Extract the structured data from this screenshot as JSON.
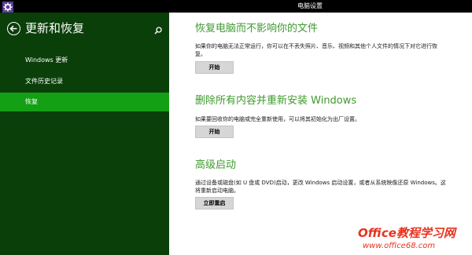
{
  "window": {
    "title": "电脑设置",
    "app_icon": "gear-icon"
  },
  "sidebar": {
    "title": "更新和恢复",
    "back_icon": "back-arrow-icon",
    "search_icon": "search-icon",
    "items": [
      {
        "label": "Windows 更新",
        "active": false
      },
      {
        "label": "文件历史记录",
        "active": false
      },
      {
        "label": "恢复",
        "active": true
      }
    ]
  },
  "sections": [
    {
      "title": "恢复电脑而不影响你的文件",
      "description": "如果你的电脑无法正常运行，你可以在不丢失照片、音乐、视频和其他个人文件的情况下对它进行恢复。",
      "button": "开始"
    },
    {
      "title": "删除所有内容并重新安装 Windows",
      "description": "如果要回收你的电脑或完全重新使用，可以将其初始化为出厂设置。",
      "button": "开始"
    },
    {
      "title": "高级启动",
      "description": "通过设备或磁盘(如 U 盘或 DVD)启动，更改 Windows 启动设置，或者从系统映像还原 Windows。这将重新启动电脑。",
      "button": "立即重启"
    }
  ],
  "watermark": {
    "line1": "Office教程学习网",
    "line2": "www.office68.com"
  },
  "colors": {
    "sidebar_bg": "#0a3f0a",
    "active_item": "#14a014",
    "section_title": "#3f9a2e",
    "watermark": "#e8321e"
  }
}
